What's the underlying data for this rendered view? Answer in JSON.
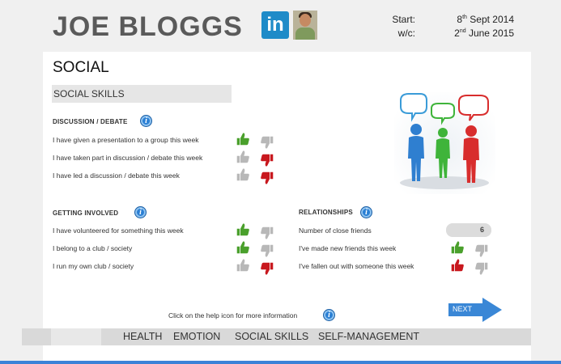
{
  "header": {
    "name": "JOE BLOGGS",
    "linkedin_label": "in",
    "start_label": "Start:",
    "start_day": "8",
    "start_suffix": "th",
    "start_rest": " Sept 2014",
    "wc_label": "w/c:",
    "wc_day": "2",
    "wc_suffix": "nd",
    "wc_rest": " June 2015"
  },
  "page": {
    "title": "SOCIAL",
    "subtitle": "SOCIAL SKILLS"
  },
  "discussion": {
    "heading": "DISCUSSION / DEBATE",
    "rows": [
      {
        "text": "I have given a presentation to a group this week",
        "selected": "up"
      },
      {
        "text": "I have taken part in discussion / debate this week",
        "selected": "down"
      },
      {
        "text": "I have led a discussion / debate this week",
        "selected": "down"
      }
    ]
  },
  "getting_involved": {
    "heading": "GETTING INVOLVED",
    "rows": [
      {
        "text": "I have volunteered for something this week",
        "selected": "up"
      },
      {
        "text": "I belong to a club / society",
        "selected": "up"
      },
      {
        "text": "I run my own club / society",
        "selected": "down"
      }
    ]
  },
  "relationships": {
    "heading": "RELATIONSHIPS",
    "close_friends_label": "Number of close friends",
    "close_friends_value": "6",
    "rows": [
      {
        "text": "I've made new friends this week",
        "selected": "up"
      },
      {
        "text": "I've fallen out with someone this week",
        "selected": "up-red"
      }
    ]
  },
  "footer": {
    "help_text": "Click on the help icon for more information",
    "next_label": "NEXT"
  },
  "nav": {
    "tabs": [
      "HEALTH",
      "EMOTION",
      "SOCIAL SKILLS",
      "SELF-MANAGEMENT"
    ]
  },
  "colors": {
    "thumb_up_active": "#4aa02c",
    "thumb_down_active": "#c8181e",
    "thumb_inactive": "#b8b8b8",
    "help_blue": "#2a7fd4",
    "linkedin_blue": "#1f8bc8",
    "next_blue": "#3a87d6"
  }
}
